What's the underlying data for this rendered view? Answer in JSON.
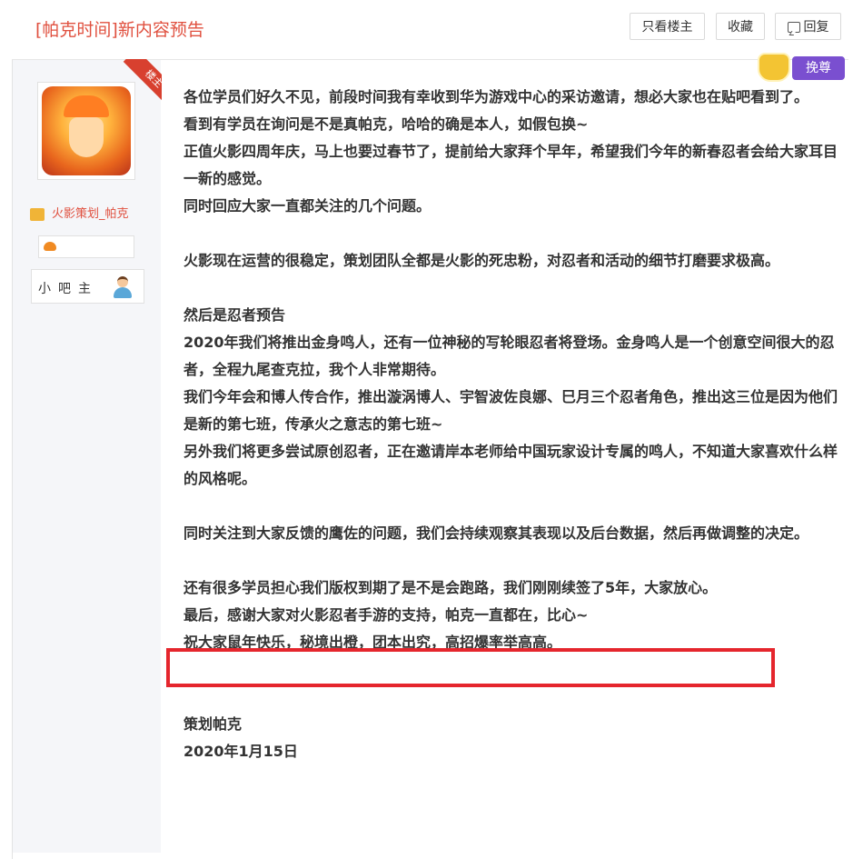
{
  "page": {
    "title": "[帕克时间]新内容预告"
  },
  "toolbar": {
    "only_op_label": "只看楼主",
    "favorite_label": "收藏",
    "reply_label": "回复",
    "reply_icon": "reply-icon"
  },
  "author": {
    "ribbon": "楼主",
    "name": "火影策划_帕克",
    "role": "小吧主",
    "avatar_icon": "avatar-image",
    "name_icon": "crown-icon",
    "badge_icon": "forum-badge-icon",
    "role_icon": "person-icon"
  },
  "top_badge": {
    "label": "挽尊",
    "icon": "crown-icon"
  },
  "content": {
    "lines": [
      "各位学员们好久不见，前段时间我有幸收到华为游戏中心的采访邀请，想必大家也在贴吧看到了。",
      "看到有学员在询问是不是真帕克，哈哈的确是本人，如假包换~",
      "正值火影四周年庆，马上也要过春节了，提前给大家拜个早年，希望我们今年的新春忍者会给大家耳目一新的感觉。",
      "同时回应大家一直都关注的几个问题。",
      "",
      "火影现在运营的很稳定，策划团队全都是火影的死忠粉，对忍者和活动的细节打磨要求极高。",
      "",
      "然后是忍者预告",
      "2020年我们将推出金身鸣人，还有一位神秘的写轮眼忍者将登场。金身鸣人是一个创意空间很大的忍者，全程九尾查克拉，我个人非常期待。",
      "我们今年会和博人传合作，推出漩涡博人、宇智波佐良娜、巳月三个忍者角色，推出这三位是因为他们是新的第七班，传承火之意志的第七班~",
      "另外我们将更多尝试原创忍者，正在邀请岸本老师给中国玩家设计专属的鸣人，不知道大家喜欢什么样的风格呢。",
      "",
      "同时关注到大家反馈的鹰佐的问题，我们会持续观察其表现以及后台数据，然后再做调整的决定。",
      "",
      "还有很多学员担心我们版权到期了是不是会跑路，我们刚刚续签了5年，大家放心。",
      "最后，感谢大家对火影忍者手游的支持，帕克一直都在，比心~",
      "祝大家鼠年快乐，秘境出橙，团本出究，高招爆率举高高。",
      "",
      "",
      "策划帕克",
      "2020年1月15日"
    ]
  },
  "colors": {
    "accent": "#e0503f",
    "highlight_border": "#e5262d",
    "sidebar_bg": "#f5f6f9",
    "badge_purple": "#7a4fd0"
  }
}
